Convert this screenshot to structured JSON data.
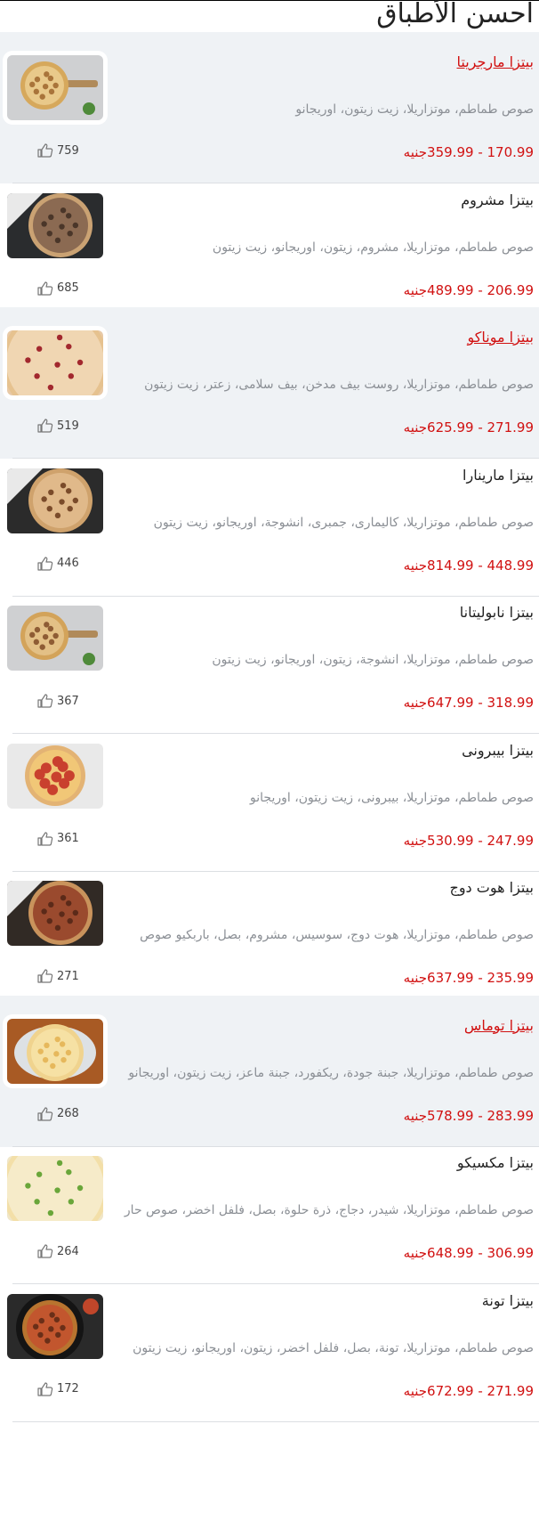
{
  "page": {
    "title": "احسن الأطباق"
  },
  "currency": "جنيه",
  "colors": {
    "accent": "#d11111",
    "shaded_row": "#eff2f5",
    "description": "#8b8f95"
  },
  "items": [
    {
      "name": "بيتزا مارجريتا",
      "linked": true,
      "description": "صوص طماطم، موتزاريلا، زيت زيتون، اوريجانو",
      "price_range": "170.99 - 359.99",
      "likes": "759",
      "image": "pizza-on-board",
      "bg": "#cfd0d2",
      "crust": "#d6a85c",
      "top": "#e9c98a",
      "spots": "#a9743a",
      "shaded": true
    },
    {
      "name": "بيتزا مشروم",
      "linked": false,
      "description": "صوص طماطم، موتزاريلا، مشروم، زيتون، اوريجانو، زيت زيتون",
      "price_range": "206.99 - 489.99",
      "likes": "685",
      "image": "pizza-dark-box",
      "bg": "#2a2c2e",
      "crust": "#caa273",
      "top": "#8b6a52",
      "spots": "#4a3629",
      "shaded": false
    },
    {
      "name": "بيتزا موناكو",
      "linked": true,
      "description": "صوص طماطم، موتزاريلا، روست بيف مدخن، بيف سلامى، زعتر، زيت زيتون",
      "price_range": "271.99 - 625.99",
      "likes": "519",
      "image": "pizza-closeup",
      "bg": "#e8c9a6",
      "crust": "#e6c28f",
      "top": "#f0d6b2",
      "spots": "#a2282e",
      "shaded": true
    },
    {
      "name": "بيتزا مارينارا",
      "linked": false,
      "description": "صوص طماطم، موتزاريلا، كاليمارى، جمبرى، انشوجة، اوريجانو، زيت زيتون",
      "price_range": "448.99 - 814.99",
      "likes": "446",
      "image": "pizza-dark-box",
      "bg": "#2b2b2b",
      "crust": "#cfa26c",
      "top": "#e0b98a",
      "spots": "#7a4b2a",
      "shaded": false
    },
    {
      "name": "بيتزا نابوليتانا",
      "linked": false,
      "description": "صوص طماطم، موتزاريلا، انشوجة، زيتون، اوريجانو، زيت زيتون",
      "price_range": "318.99 - 647.99",
      "likes": "367",
      "image": "pizza-on-board",
      "bg": "#cfd0d2",
      "crust": "#d3a35a",
      "top": "#e3c086",
      "spots": "#8e5c34",
      "shaded": false
    },
    {
      "name": "بيتزا بيبرونى",
      "linked": false,
      "description": "صوص طماطم، موتزاريلا، بيبرونى، زيت زيتون، اوريجانو",
      "price_range": "247.99 - 530.99",
      "likes": "361",
      "image": "pizza-pepperoni",
      "bg": "#e9e9e9",
      "crust": "#e3b374",
      "top": "#f1c777",
      "spots": "#c9402e",
      "shaded": false
    },
    {
      "name": "بيتزا هوت دوج",
      "linked": false,
      "description": "صوص طماطم، موتزاريلا، هوت دوج، سوسيس، مشروم، بصل، باربكيو صوص",
      "price_range": "235.99 - 637.99",
      "likes": "271",
      "image": "pizza-dark-box",
      "bg": "#312a25",
      "crust": "#c9935c",
      "top": "#9a4a2e",
      "spots": "#5b2a19",
      "shaded": false
    },
    {
      "name": "بيتزا توماس",
      "linked": true,
      "description": "صوص طماطم، موتزاريلا، جبنة جودة، ريكفورد، جبنة ماعز، زيت زيتون، اوريجانو",
      "price_range": "283.99 - 578.99",
      "likes": "268",
      "image": "pizza-on-plate",
      "bg": "#a85a24",
      "crust": "#f0d38e",
      "top": "#f6e1a4",
      "spots": "#e6b85c",
      "shaded": true
    },
    {
      "name": "بيتزا مكسيكو",
      "linked": false,
      "description": "صوص طماطم، موتزاريلا، شيدر، دجاج، ذرة حلوة، بصل، فلفل اخضر، صوص حار",
      "price_range": "306.99 - 648.99",
      "likes": "264",
      "image": "pizza-closeup",
      "bg": "#f0e6c8",
      "crust": "#f3dfa8",
      "top": "#f6ebc9",
      "spots": "#6aa63a",
      "shaded": false
    },
    {
      "name": "بيتزا تونة",
      "linked": false,
      "description": "صوص طماطم، موتزاريلا، تونة، بصل، فلفل اخضر، زيتون، اوريجانو، زيت زيتون",
      "price_range": "271.99 - 672.99",
      "likes": "172",
      "image": "pizza-pan",
      "bg": "#2a2a2a",
      "crust": "#b8742f",
      "top": "#c2562e",
      "spots": "#6a2f18",
      "shaded": false
    }
  ]
}
